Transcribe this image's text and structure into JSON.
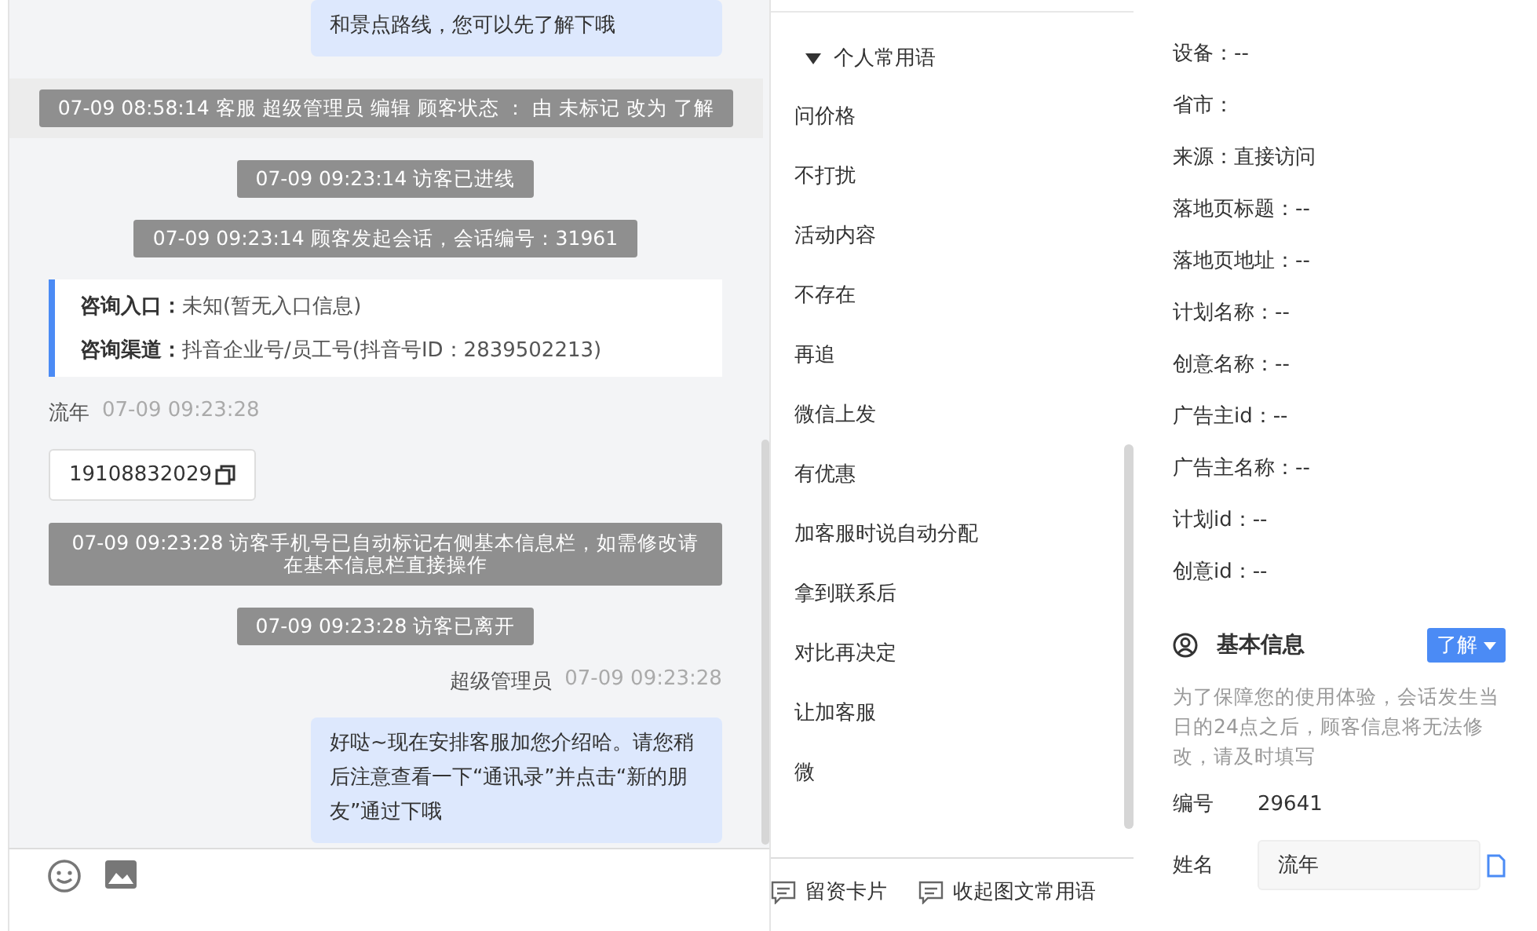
{
  "chat": {
    "messages": [
      {
        "kind": "bubble_out",
        "text": "和景点路线，您可以先了解下哦"
      },
      {
        "kind": "system_band",
        "text": "07-09 08:58:14 客服 超级管理员 编辑 顾客状态 ： 由 未标记 改为 了解"
      },
      {
        "kind": "system",
        "text": "07-09 09:23:14 访客已进线"
      },
      {
        "kind": "system",
        "text": "07-09 09:23:14 顾客发起会话，会话编号：31961"
      },
      {
        "kind": "source_card",
        "rows": [
          {
            "label": "咨询入口：",
            "value": "未知(暂无入口信息)"
          },
          {
            "label": "咨询渠道：",
            "value": "抖音企业号/员工号(抖音号ID：2839502213)"
          }
        ]
      },
      {
        "kind": "sender_left",
        "name": "流年",
        "time": "07-09 09:23:28"
      },
      {
        "kind": "phone_card",
        "text": "19108832029"
      },
      {
        "kind": "system_wide",
        "text": "07-09 09:23:28 访客手机号已自动标记右侧基本信息栏，如需修改请在基本信息栏直接操作"
      },
      {
        "kind": "system",
        "text": "07-09 09:23:28 访客已离开"
      },
      {
        "kind": "sender_right",
        "name": "超级管理员",
        "time": "07-09 09:23:28"
      },
      {
        "kind": "bubble_out",
        "text": "好哒~现在安排客服加您介绍哈。请您稍后注意查看一下“通讯录”并点击“新的朋友”通过下哦"
      }
    ]
  },
  "phrases": {
    "group": {
      "label": "个人常用语",
      "expanded": true
    },
    "items": [
      "问价格",
      "不打扰",
      "活动内容",
      "不存在",
      "再追",
      "微信上发",
      "有优惠",
      "加客服时说自动分配",
      "拿到联系后",
      "对比再决定",
      "让加客服",
      "微"
    ],
    "actions": [
      "留资卡片",
      "收起图文常用语"
    ]
  },
  "source_info": [
    "设备：--",
    "省市：",
    "来源：直接访问",
    "落地页标题：--",
    "落地页地址：--",
    "计划名称：--",
    "创意名称：--",
    "广告主id：--",
    "广告主名称：--",
    "计划id：--",
    "创意id：--"
  ],
  "basic_info": {
    "title": "基本信息",
    "status": "了解",
    "note": "为了保障您的使用体验，会话发生当日的24点之后，顾客信息将无法修改，请及时填写",
    "id_label": "编号",
    "id_value": "29641",
    "name_label": "姓名",
    "name_value": "流年"
  }
}
